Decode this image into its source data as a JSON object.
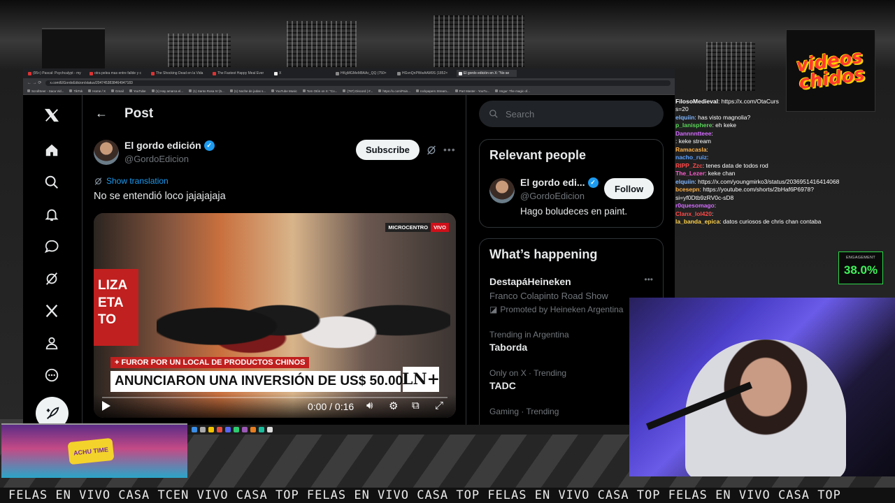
{
  "browser": {
    "tabs": [
      {
        "label": "(95+) Pascal: Psychcalypt - my"
      },
      {
        "label": "otra pelea mas entre fallde y c"
      },
      {
        "label": "The Shocking Dead en la Vida"
      },
      {
        "label": "The Fastest Happy Meal Ever"
      },
      {
        "label": "X"
      },
      {
        "label": "HKgMGMeM8AAc_QQ (750×"
      },
      {
        "label": "HGvnQnPWwAAM9S (1852×"
      },
      {
        "label": "El gordo edición en X: \"No se"
      }
    ],
    "url": "x.com/ElGordoEdicion/status/2047453838464947183",
    "bookmarks": [
      "ScrollSeer - Saca Vid...",
      "TikTok",
      "Home / X",
      "Gmail",
      "YouTube",
      "(1) Hay amarca el...",
      "(1) Santo Rosa IV (5...",
      "(1) Noche de jodas s...",
      "YouTube Music",
      "Tom Otón on X: \"Co...",
      "(787) Discord | #...",
      "https://x.com/Pain...",
      "rockpapers Stream...",
      "Part Master - YouTu...",
      "Imgur: The magic of..."
    ]
  },
  "x": {
    "header_title": "Post",
    "author": {
      "name": "El gordo edición",
      "handle": "@GordoEdicion"
    },
    "subscribe_label": "Subscribe",
    "show_translation": "Show translation",
    "tweet_text": "No se entendió loco jajajajaja",
    "video": {
      "sign_text": "LIZA\nETA\nTO",
      "badge_left": "MICROCENTRO",
      "badge_right": "VIVO",
      "kicker": "+ FUROR POR UN LOCAL DE PRODUCTOS CHINOS",
      "headline": "ANUNCIARON UNA INVERSIÓN DE US$ 50.000",
      "channel_logo": "LN+",
      "timecode": "0:00 / 0:16"
    },
    "search_placeholder": "Search",
    "relevant_people": {
      "title": "Relevant people",
      "name": "El gordo edi...",
      "handle": "@GordoEdicion",
      "bio": "Hago boludeces en paint.",
      "follow_label": "Follow"
    },
    "whats_happening": {
      "title": "What’s happening",
      "trends": [
        {
          "meta": "",
          "name": "DestapáHeineken",
          "sub": "Franco Colapinto Road Show",
          "promo": "Promoted by Heineken Argentina"
        },
        {
          "meta": "Trending in Argentina",
          "name": "Taborda",
          "sub": "",
          "promo": ""
        },
        {
          "meta": "Only on X · Trending",
          "name": "TADC",
          "sub": "",
          "promo": ""
        },
        {
          "meta": "Gaming · Trending",
          "name": "",
          "sub": "",
          "promo": ""
        }
      ]
    }
  },
  "stream": {
    "logo_text": "videos chidos",
    "chat": [
      {
        "user": "FilosoMedieval",
        "color": "#ffffff",
        "text": ": https://x.com/OtaCurs"
      },
      {
        "user": "",
        "color": "#ffffff",
        "text": "s=20"
      },
      {
        "user": "elquiin",
        "color": "#7fb6ff",
        "text": ": has visto magnolia?"
      },
      {
        "user": "p_lanisphere",
        "color": "#5bd85b",
        "text": ": eh keke"
      },
      {
        "user": "Dannnntteee",
        "color": "#d46cff",
        "text": ":"
      },
      {
        "user": "",
        "color": "#ff4a4a",
        "text": ": keke stream"
      },
      {
        "user": "Ramacasla",
        "color": "#ffb24a",
        "text": ":"
      },
      {
        "user": "nacho_ruiz",
        "color": "#5aa0ff",
        "text": ":"
      },
      {
        "user": "RIPP_Zzc",
        "color": "#ff4a4a",
        "text": ": tenes data de todos rod"
      },
      {
        "user": "The_Lezer",
        "color": "#ff5bd0",
        "text": ": keke chan"
      },
      {
        "user": "elquiin",
        "color": "#7fb6ff",
        "text": ": https://x.com/youngmirko3/status/2036951416414068"
      },
      {
        "user": "bcesepn",
        "color": "#ffb24a",
        "text": ": https://youtube.com/shorts/2bHaf6P6978?"
      },
      {
        "user": "",
        "color": "#ffffff",
        "text": "si=yf0Dtb9zRV0c-sD8"
      },
      {
        "user": "r0quesomago",
        "color": "#d46cff",
        "text": ":"
      },
      {
        "user": "Clanx_lol420",
        "color": "#ff4a4a",
        "text": ":"
      },
      {
        "user": "la_banda_epica",
        "color": "#ffd24a",
        "text": ": datos curiosos de chris chan contaba"
      }
    ],
    "engagement_label": "ENGAGEMENT",
    "engagement_value": "38.0%",
    "minigame_sign": "ACHU TIME",
    "ticker": "FELAS EN VIVO CASA TCEN VIVO CASA TOP FELAS EN VIVO CASA TOP FELAS EN VIVO CASA TOP FELAS EN VIVO CASA TOP"
  },
  "colors": {
    "x_blue": "#1d9bf0",
    "x_text": "#e7e9ea",
    "x_muted": "#71767b",
    "engagement_green": "#3ff25a"
  }
}
